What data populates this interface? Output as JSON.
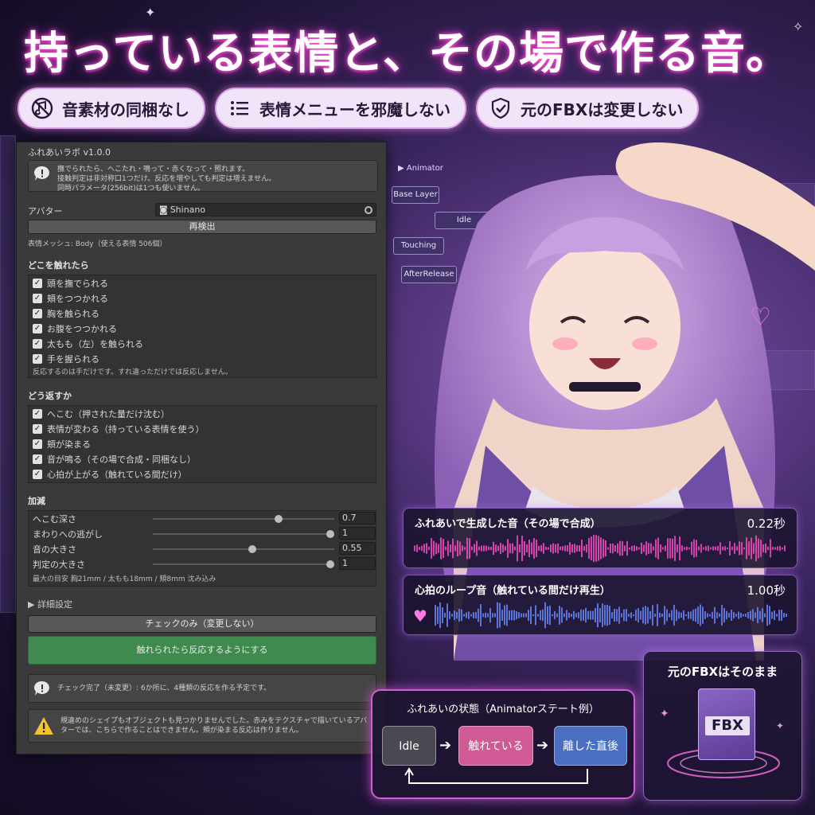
{
  "headline": "持っている表情と、その場で作る音。",
  "pills": [
    {
      "icon": "no-music-icon",
      "label": "音素材の同梱なし"
    },
    {
      "icon": "list-icon",
      "label": "表情メニューを邪魔しない"
    },
    {
      "icon": "shield-check-icon",
      "label": "元のFBXは変更しない"
    }
  ],
  "panel": {
    "title": "ふれあいラボ v1.0.0",
    "intro_help": [
      "撫でられたら、へこたれ・鳴って・赤くなって・照れます。",
      "接触判定は非対称口1つだけ。反応を増やしても判定は増えません。",
      "同時パラメータ(256bit)は1つも使いません。"
    ],
    "avatar_label": "アバター",
    "avatar_value": "Shinano",
    "redetect_button": "再検出",
    "mesh_info": "表情メッシュ: Body（使える表情 506個）",
    "touch_section": {
      "title": "どこを触れたら",
      "items": [
        "頭を撫でられる",
        "頬をつつかれる",
        "胸を触られる",
        "お腹をつつかれる",
        "太もも（左）を触られる",
        "手を握られる"
      ],
      "note": "反応するのは手だけです。すれ違っただけでは反応しません。"
    },
    "response_section": {
      "title": "どう返すか",
      "items": [
        "へこむ（押された量だけ沈む）",
        "表情が変わる（持っている表情を使う）",
        "頬が染まる",
        "音が鳴る（その場で合成・同梱なし）",
        "心拍が上がる（触れている間だけ）"
      ]
    },
    "adjust_section": {
      "title": "加減",
      "sliders": [
        {
          "label": "へこむ深さ",
          "value": 0.7,
          "display": "0.7"
        },
        {
          "label": "まわりへの逃がし",
          "value": 1,
          "display": "1"
        },
        {
          "label": "音の大きさ",
          "value": 0.55,
          "display": "0.55"
        },
        {
          "label": "判定の大きさ",
          "value": 1,
          "display": "1"
        }
      ],
      "note": "最大の目安  胸21mm / 太もも18mm / 頬8mm 沈み込み"
    },
    "advanced_label": "▶ 詳細設定",
    "check_button": "チェックのみ（変更しない）",
    "apply_button": "触れられたら反応するようにする",
    "result_help": "チェック完了（未変更）: 6か所に、4種類の反応を作る予定です。",
    "warning_help": [
      "規違めのシェイプもオブジェクトも見つかりませんでした。赤みをテクスチャで描いているアバ",
      "ターでは、こちらで作ることはできません。頬が染まる反応は作りません。"
    ]
  },
  "animator": {
    "title": "Animator",
    "layer": "Base Layer",
    "nodes": [
      "Idle",
      "Touching",
      "AfterRelease"
    ]
  },
  "waves": [
    {
      "title": "ふれあいで生成した音（その場で合成）",
      "duration": "0.22秒",
      "color": "#ff4fc8"
    },
    {
      "title": "心拍のループ音（触れている間だけ再生）",
      "duration": "1.00秒",
      "color": "#6b8cff"
    }
  ],
  "state_diagram": {
    "title": "ふれあいの状態（Animatorステート例）",
    "states": [
      {
        "label": "Idle",
        "color": "#4a4a52"
      },
      {
        "label": "触れている",
        "color": "#d05a93"
      },
      {
        "label": "離した直後",
        "color": "#4a6fc0"
      }
    ]
  },
  "fbx_card": {
    "title": "元のFBXはそのまま",
    "file_label": "FBX"
  }
}
